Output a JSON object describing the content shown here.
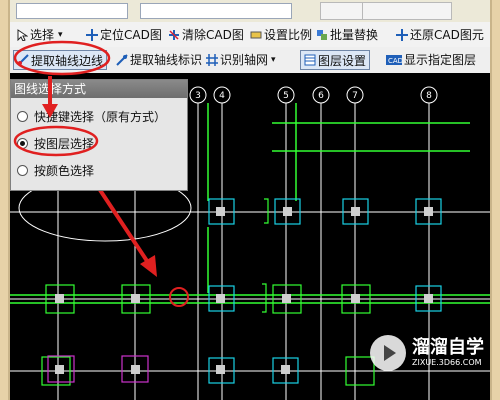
{
  "toolbar": {
    "items": [
      {
        "label": "选择",
        "icon": "cursor-icon"
      },
      {
        "label": "定位CAD图",
        "icon": "locate-icon"
      },
      {
        "label": "清除CAD图",
        "icon": "clear-icon"
      },
      {
        "label": "设置比例",
        "icon": "scale-icon"
      },
      {
        "label": "批量替换",
        "icon": "replace-icon"
      },
      {
        "label": "还原CAD图元",
        "icon": "restore-icon"
      }
    ]
  },
  "toolbar2": {
    "items": [
      {
        "label": "提取轴线边线",
        "icon": "extract-axis-icon",
        "pressed": true
      },
      {
        "label": "提取轴线标识",
        "icon": "extract-mark-icon"
      },
      {
        "label": "识别轴网",
        "icon": "recognize-grid-icon"
      },
      {
        "label": "图层设置",
        "icon": "layer-icon",
        "pressed": true
      },
      {
        "label": "显示指定图层",
        "icon": "cad-layer-icon"
      }
    ]
  },
  "panel": {
    "title": "图线选择方式",
    "options": [
      {
        "label": "快捷键选择（原有方式）",
        "checked": false
      },
      {
        "label": "按图层选择",
        "checked": true
      },
      {
        "label": "按颜色选择",
        "checked": false
      }
    ]
  },
  "axis_labels": [
    "3",
    "4",
    "5",
    "6",
    "7",
    "8"
  ],
  "watermark": {
    "line1": "溜溜自学",
    "line2": "ZIXUE.3D66.COM"
  },
  "colors": {
    "cad_bg": "#000000",
    "grid_line": "#ffffff",
    "column_cyan": "#19d1e6",
    "column_green": "#33ff33",
    "column_magenta": "#cc33cc",
    "annotation_red": "#e02020"
  }
}
